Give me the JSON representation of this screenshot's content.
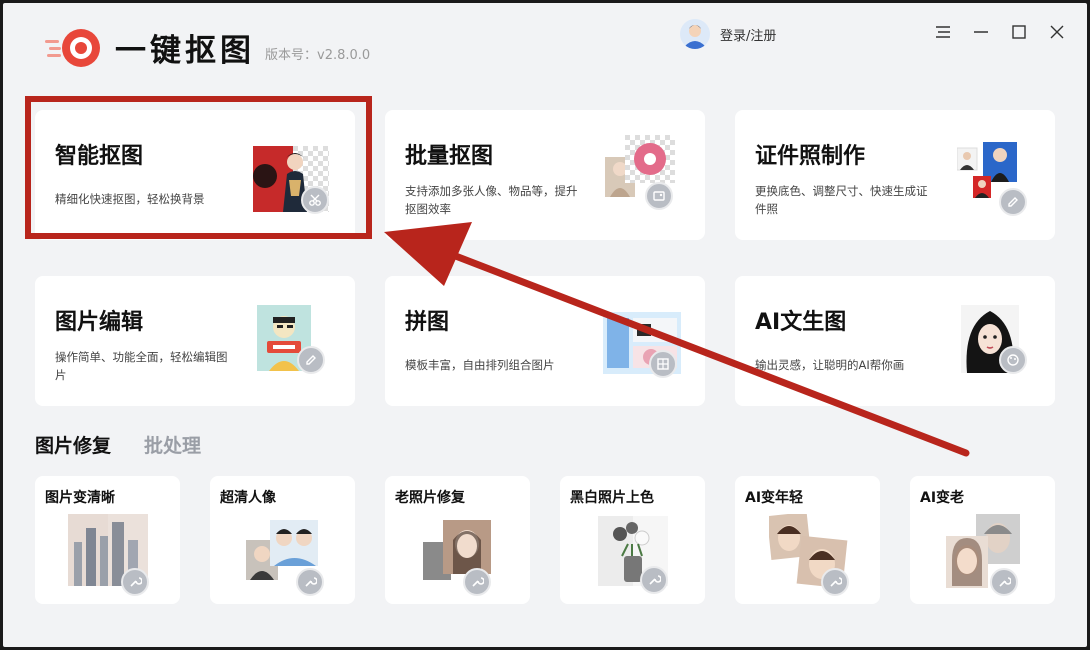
{
  "header": {
    "app_title": "一键抠图",
    "version": "版本号：v2.8.0.0",
    "login_label": "登录/注册"
  },
  "feature_cards": [
    {
      "title": "智能抠图",
      "desc": "精细化快速抠图，轻松换背景"
    },
    {
      "title": "批量抠图",
      "desc": "支持添加多张人像、物品等，提升抠图效率"
    },
    {
      "title": "证件照制作",
      "desc": "更换底色、调整尺寸、快速生成证件照"
    },
    {
      "title": "图片编辑",
      "desc": "操作简单、功能全面，轻松编辑图片"
    },
    {
      "title": "拼图",
      "desc": "模板丰富，自由排列组合图片"
    },
    {
      "title": "AI文生图",
      "desc": "输出灵感，让聪明的AI帮你画"
    }
  ],
  "tabs": [
    {
      "label": "图片修复",
      "active": true
    },
    {
      "label": "批处理",
      "active": false
    }
  ],
  "repair_tools": [
    {
      "title": "图片变清晰"
    },
    {
      "title": "超清人像"
    },
    {
      "title": "老照片修复"
    },
    {
      "title": "黑白照片上色"
    },
    {
      "title": "AI变年轻"
    },
    {
      "title": "AI变老"
    }
  ],
  "colors": {
    "brand_red": "#e8473a",
    "annotation_red": "#b8251c",
    "background": "#f2f3f5"
  }
}
